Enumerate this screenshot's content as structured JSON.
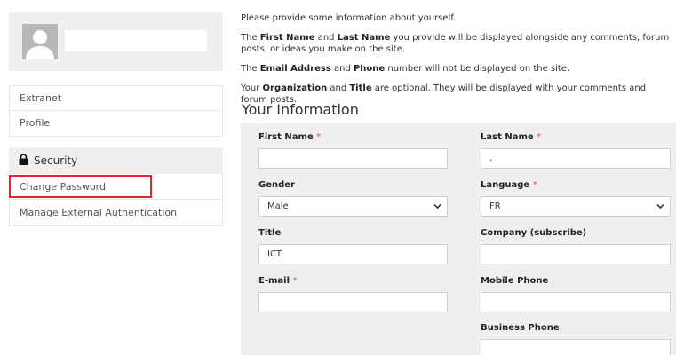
{
  "sidebar": {
    "nav_items": [
      "Extranet",
      "Profile"
    ],
    "security": {
      "header": "Security",
      "items": [
        "Change Password",
        "Manage External Authentication"
      ]
    }
  },
  "intro": {
    "p1": "Please provide some information about yourself.",
    "p2": {
      "pre": "The ",
      "b1": "First Name",
      "mid": " and ",
      "b2": "Last Name",
      "post": " you provide will be displayed alongside any comments, forum posts, or ideas you make on the site."
    },
    "p3": {
      "pre": "The ",
      "b1": "Email Address",
      "mid": " and ",
      "b2": "Phone",
      "post": " number will not be displayed on the site."
    },
    "p4": {
      "pre": "Your ",
      "b1": "Organization",
      "mid": " and ",
      "b2": "Title",
      "post": " are optional. They will be displayed with your comments and forum posts."
    }
  },
  "form": {
    "title": "Your Information",
    "required_mark": "*",
    "first_name": {
      "label": "First Name",
      "value": ""
    },
    "last_name": {
      "label": "Last Name",
      "value": "."
    },
    "gender": {
      "label": "Gender",
      "value": "Male"
    },
    "language": {
      "label": "Language",
      "value": "FR"
    },
    "title_field": {
      "label": "Title",
      "value": "ICT"
    },
    "company": {
      "label": "Company (subscribe)",
      "value": ""
    },
    "email": {
      "label": "E-mail",
      "value": ""
    },
    "mobile_phone": {
      "label": "Mobile Phone",
      "value": ""
    },
    "business_phone": {
      "label": "Business Phone",
      "value": ""
    }
  },
  "colors": {
    "highlight": "#e0262f",
    "required": "#d9534f",
    "panel": "#efefef"
  }
}
